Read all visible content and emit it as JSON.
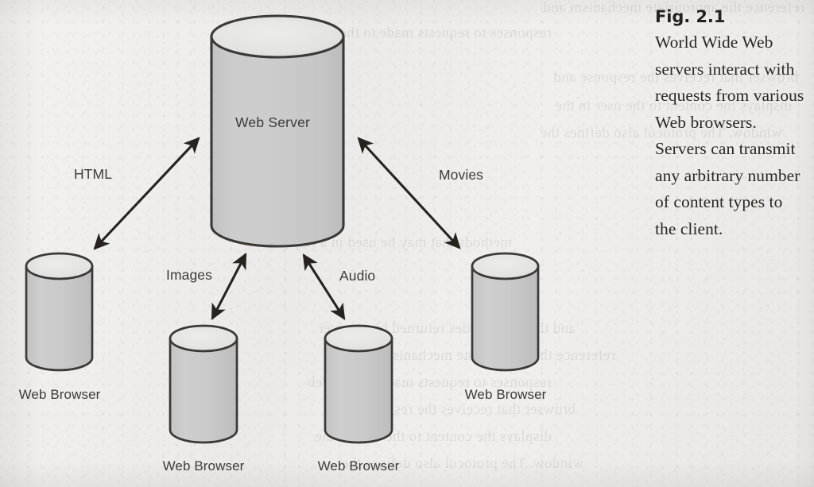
{
  "figure": {
    "caption_number": "Fig. 2.1",
    "caption_body": "World Wide Web servers interact with requests from various Web browsers. Servers can transmit any arbitrary number of content types to the client."
  },
  "diagram": {
    "type": "node-link",
    "server": {
      "label": "Web Server",
      "shape": "cylinder"
    },
    "clients": [
      {
        "id": "client-left",
        "label": "Web Browser",
        "shape": "cylinder"
      },
      {
        "id": "client-center-left",
        "label": "Web Browser",
        "shape": "cylinder"
      },
      {
        "id": "client-center-right",
        "label": "Web Browser",
        "shape": "cylinder"
      },
      {
        "id": "client-right",
        "label": "Web Browser",
        "shape": "cylinder"
      }
    ],
    "connections": [
      {
        "id": "edge-html",
        "label": "HTML",
        "from": "client-left",
        "to": "server",
        "arrow": "double"
      },
      {
        "id": "edge-images",
        "label": "Images",
        "from": "client-center-left",
        "to": "server",
        "arrow": "double"
      },
      {
        "id": "edge-audio",
        "label": "Audio",
        "from": "client-center-right",
        "to": "server",
        "arrow": "double"
      },
      {
        "id": "edge-movies",
        "label": "Movies",
        "from": "client-right",
        "to": "server",
        "arrow": "double"
      }
    ]
  },
  "colors": {
    "page_background": "#eeedeb",
    "cylinder_body": "#c9c9c9",
    "cylinder_top": "#e4e4e2",
    "outline": "#3b3835",
    "text": "#3a3a3a",
    "caption_text": "#2b2723"
  },
  "background_bleed": {
    "note": "faint mirrored show-through of text printed on the reverse side of the page",
    "lines": [
      "reference the appropriate mechanism and",
      "responses to requests made to the Web",
      "browser that receives the response and",
      "displays the content to the user in the",
      "window. The protocol also defines the",
      "methods that may be used in a request",
      "and the status codes returned by a server"
    ]
  }
}
